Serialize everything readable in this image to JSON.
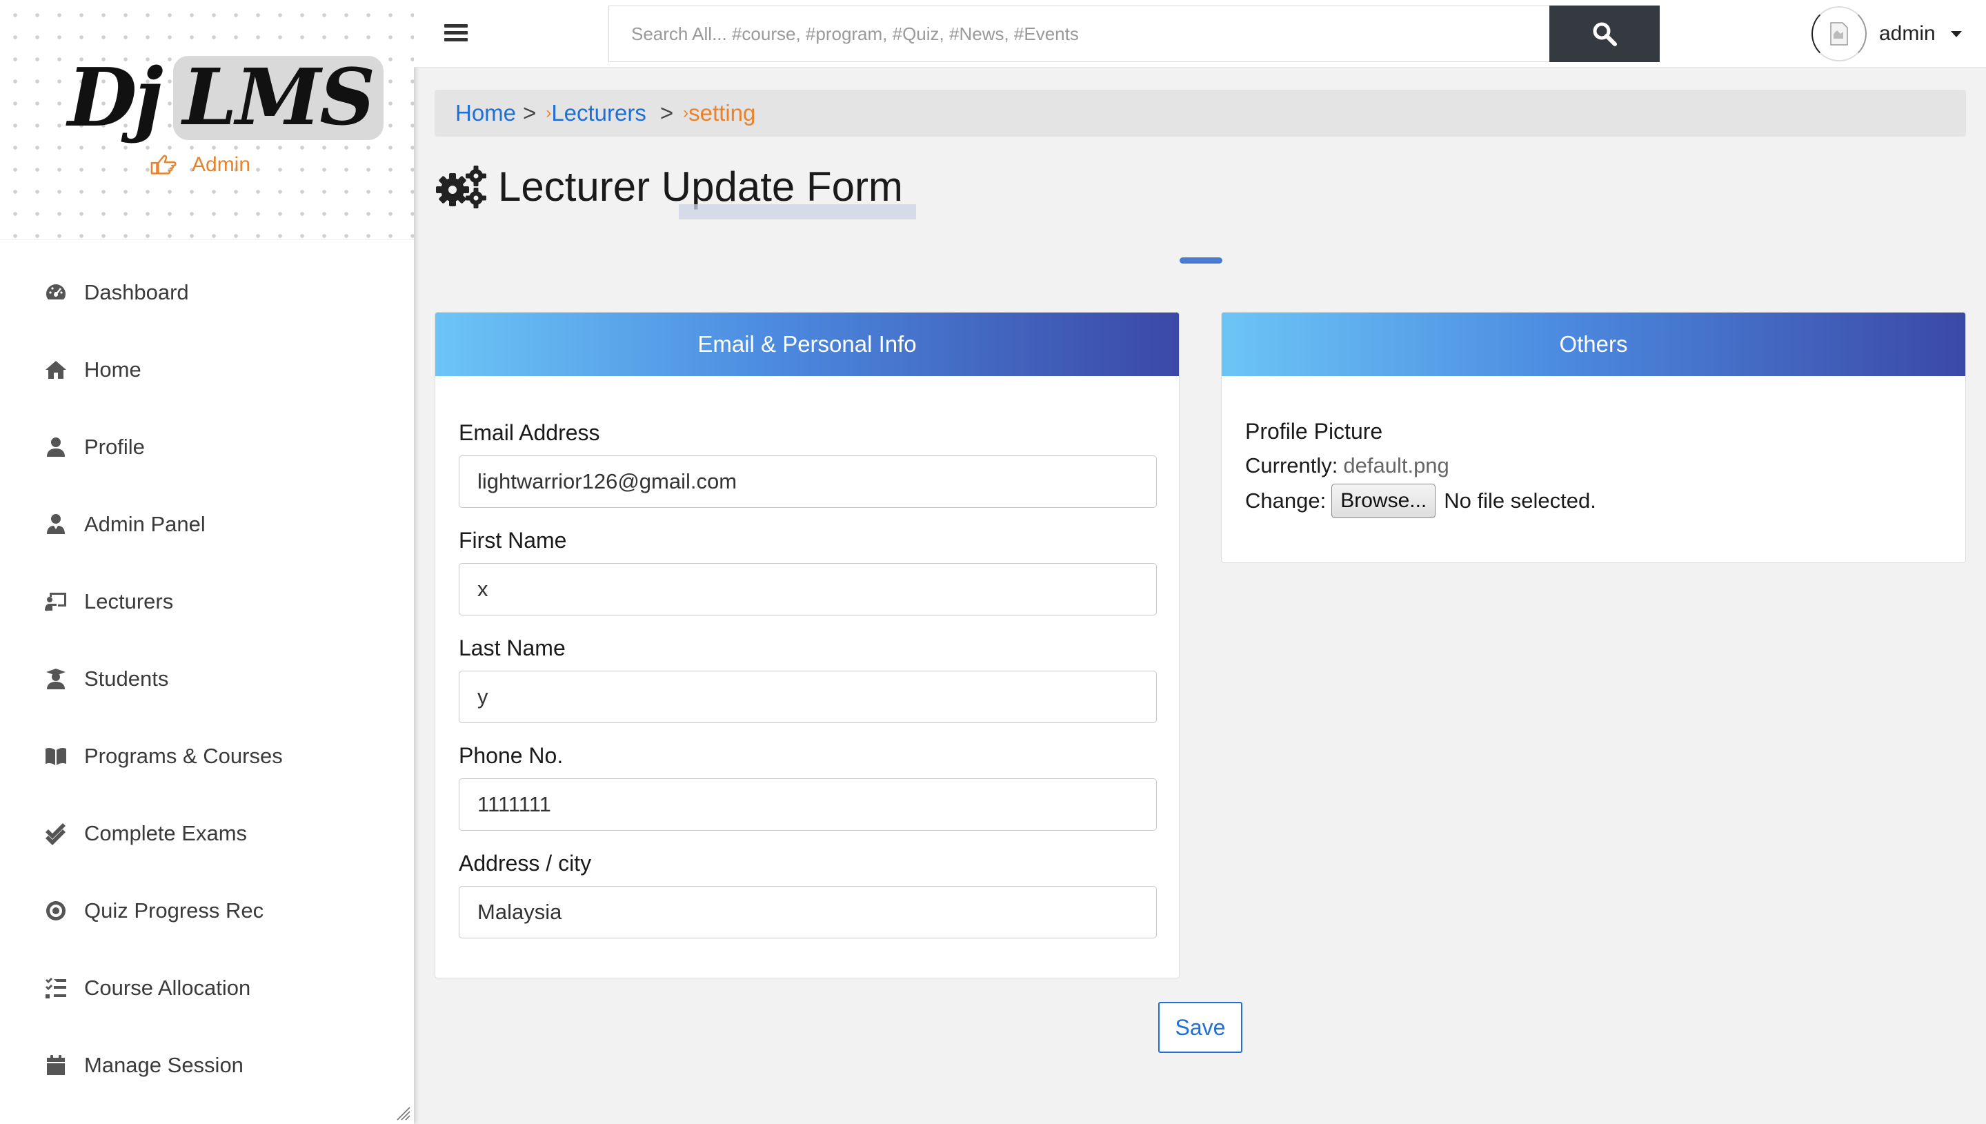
{
  "brand": {
    "logo_primary": "Dj",
    "logo_secondary": "LMS",
    "role": "Admin"
  },
  "sidebar": {
    "items": [
      {
        "label": "Dashboard",
        "icon": "gauge-icon"
      },
      {
        "label": "Home",
        "icon": "home-icon"
      },
      {
        "label": "Profile",
        "icon": "user-icon"
      },
      {
        "label": "Admin Panel",
        "icon": "user-tie-icon"
      },
      {
        "label": "Lecturers",
        "icon": "chalkboard-teacher-icon"
      },
      {
        "label": "Students",
        "icon": "user-graduate-icon"
      },
      {
        "label": "Programs & Courses",
        "icon": "book-open-icon"
      },
      {
        "label": "Complete Exams",
        "icon": "check-double-icon"
      },
      {
        "label": "Quiz Progress Rec",
        "icon": "record-icon"
      },
      {
        "label": "Course Allocation",
        "icon": "tasks-icon"
      },
      {
        "label": "Manage Session",
        "icon": "calendar-icon"
      }
    ]
  },
  "topbar": {
    "search_placeholder": "Search All... #course, #program, #Quiz, #News, #Events",
    "username": "admin"
  },
  "breadcrumb": {
    "home": "Home",
    "lecturers": "Lecturers",
    "current": "setting"
  },
  "page": {
    "title": "Lecturer Update Form"
  },
  "personal_card": {
    "header": "Email & Personal Info",
    "fields": [
      {
        "label": "Email Address",
        "value": "lightwarrior126@gmail.com"
      },
      {
        "label": "First Name",
        "value": "x"
      },
      {
        "label": "Last Name",
        "value": "y"
      },
      {
        "label": "Phone No.",
        "value": "1111111"
      },
      {
        "label": "Address / city",
        "value": "Malaysia"
      }
    ]
  },
  "others_card": {
    "header": "Others",
    "profile_picture_label": "Profile Picture",
    "currently_label": "Currently:",
    "currently_value": "default.png",
    "change_label": "Change:",
    "browse_label": "Browse...",
    "no_file": "No file selected."
  },
  "actions": {
    "save": "Save"
  },
  "colors": {
    "accent_orange": "#e8822b",
    "link_blue": "#1f6fd6",
    "header_grad_start": "#6cc5f6",
    "header_grad_end": "#3b48a6",
    "search_btn": "#343a40"
  }
}
